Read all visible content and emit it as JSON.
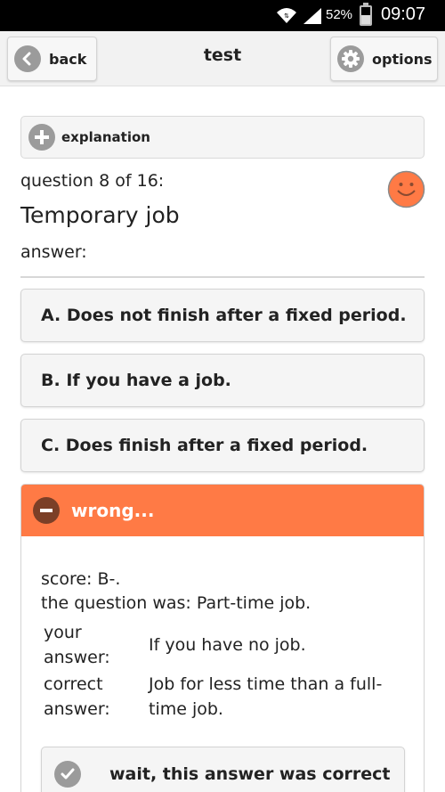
{
  "status_bar": {
    "battery": "52%",
    "battery_level": 0.52,
    "time": "09:07",
    "icons": [
      "wifi-icon",
      "signal-icon",
      "battery-icon"
    ]
  },
  "header": {
    "back_label": "back",
    "title": "test",
    "options_label": "options",
    "icons": [
      "back-arrow-icon",
      "gear-icon"
    ]
  },
  "explanation": {
    "label": "explanation",
    "icon": "plus-icon"
  },
  "question": {
    "number_text": "question 8 of 16:",
    "word": "Temporary job",
    "answer_label": "answer:",
    "mood_icon": "smiley-icon"
  },
  "options": [
    {
      "label": "A. Does not finish after a fixed period."
    },
    {
      "label": "B. If you have a job."
    },
    {
      "label": "C. Does finish after a fixed period."
    }
  ],
  "result": {
    "title": "wrong...",
    "icon": "minus-icon",
    "score": "score: B-.",
    "question_was": "the question was: Part-time job.",
    "your_answer_label": "your answer:",
    "your_answer_value": "If you have no job.",
    "correct_answer_label": "correct answer:",
    "correct_answer_value": "Job for less time than a full-time job.",
    "override_label": "wait, this answer was correct",
    "override_icon": "checkmark-icon"
  },
  "colors": {
    "status_bar": "#000000",
    "header_bg": "#f2f2f2",
    "wrong_accent": "#ff7a45",
    "smiley": "#ff7a45",
    "icon_gray": "#9b9b9b"
  }
}
